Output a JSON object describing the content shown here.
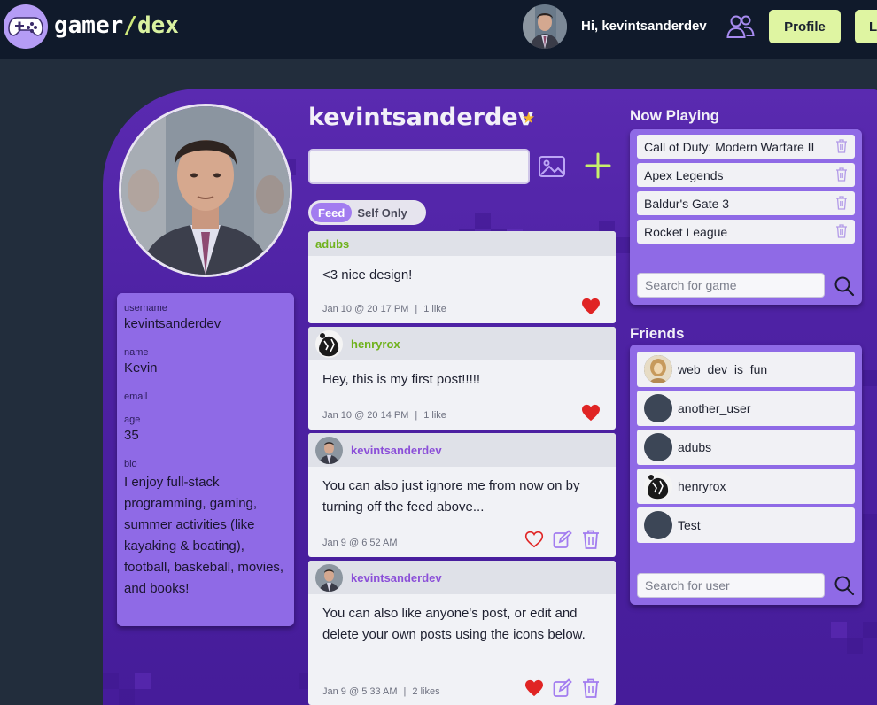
{
  "header": {
    "logo_text_1": "gamer",
    "logo_text_2": "/",
    "logo_text_3": "dex",
    "greeting": "Hi, kevintsanderdev",
    "profile_label": "Profile",
    "logout_label": "Lo"
  },
  "profile": {
    "username_heading": "kevintsanderdev",
    "fields": {
      "username_label": "username",
      "username": "kevintsanderdev",
      "name_label": "name",
      "name": "Kevin",
      "email_label": "email",
      "email": "",
      "age_label": "age",
      "age": "35",
      "bio_label": "bio",
      "bio": "I enjoy full-stack programming, gaming, summer activities (like kayaking & boating), football, baskeball, movies, and books!"
    }
  },
  "composer": {
    "placeholder": "",
    "toggle_feed": "Feed",
    "toggle_self": "Self Only"
  },
  "posts": [
    {
      "author": "adubs",
      "body": "<3 nice design!",
      "date": "Jan 10 @ 20 17 PM",
      "likes": "1 like",
      "liked": true
    },
    {
      "author": "henryrox",
      "body": "Hey, this is my first post!!!!!",
      "date": "Jan 10 @ 20 14 PM",
      "likes": "1 like",
      "liked": true
    },
    {
      "author": "kevintsanderdev",
      "body": "You can also just ignore me from now on by turning off the feed above...",
      "date": "Jan 9 @ 6 52 AM",
      "likes": "",
      "liked": false
    },
    {
      "author": "kevintsanderdev",
      "body": "You can also like anyone's post, or edit and delete your own posts using the icons below.",
      "date": "Jan 9 @ 5 33 AM",
      "likes": "2 likes",
      "liked": true
    }
  ],
  "now_playing": {
    "title": "Now Playing",
    "games": [
      "Call of Duty: Modern Warfare II",
      "Apex Legends",
      "Baldur's Gate 3",
      "Rocket League"
    ],
    "search_placeholder": "Search for game"
  },
  "friends": {
    "title": "Friends",
    "list": [
      "web_dev_is_fun",
      "another_user",
      "adubs",
      "henryrox",
      "Test"
    ],
    "search_placeholder": "Search for user"
  },
  "colors": {
    "background": "#222d3c",
    "header": "#101a2b",
    "panel": "#5a2ab0",
    "card": "#8f6ae6",
    "accent_green": "#dff5a2",
    "heart": "#e02424"
  }
}
